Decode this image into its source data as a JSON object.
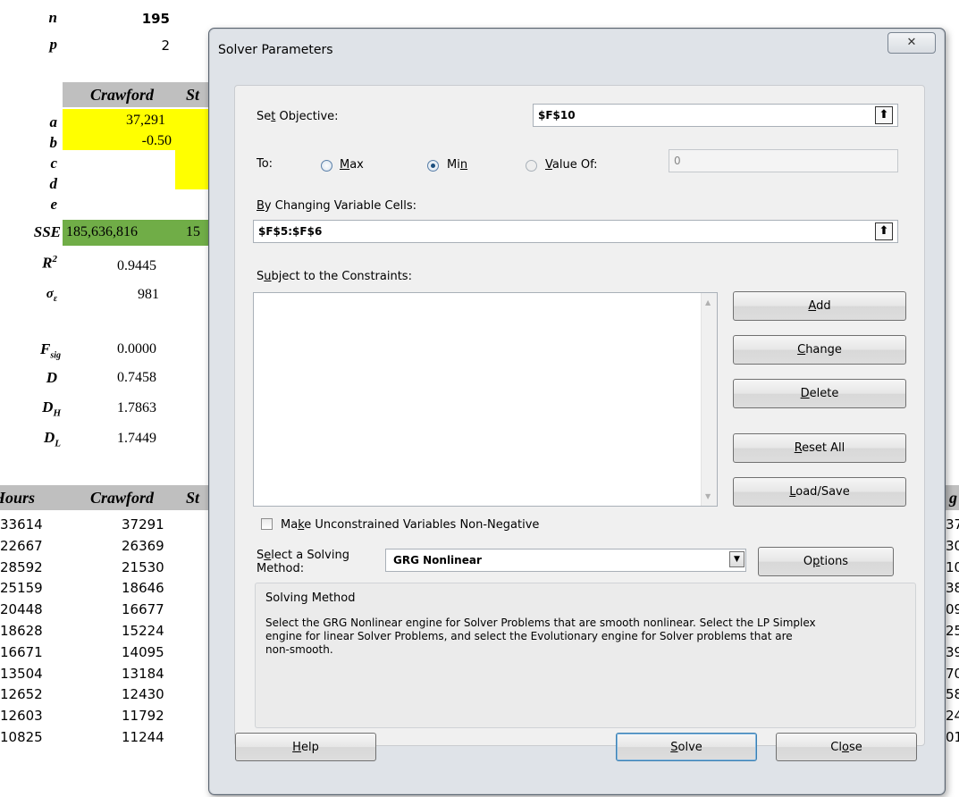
{
  "sheet": {
    "n_label": "n",
    "n_value": "195",
    "p_label": "p",
    "p_value": "2",
    "col_header_1": "Crawford",
    "col_header_2_partial": "St",
    "params": [
      {
        "label": "a",
        "value": "37,291"
      },
      {
        "label": "b",
        "value": "-0.50"
      },
      {
        "label": "c",
        "value": ""
      },
      {
        "label": "d",
        "value": ""
      },
      {
        "label": "e",
        "value": ""
      }
    ],
    "sse_label": "SSE",
    "sse_value": "185,636,816",
    "sse_partial": "15",
    "stats": [
      {
        "label": "R",
        "sup": "2",
        "sub": "",
        "value": "0.9445"
      },
      {
        "label": "σ",
        "sup": "",
        "sub": "ε",
        "value": "981"
      },
      {
        "label": "F",
        "sup": "",
        "sub": "sig",
        "value": "0.0000"
      },
      {
        "label": "D",
        "sup": "",
        "sub": "",
        "value": "0.7458"
      },
      {
        "label": "D",
        "sup": "",
        "sub": "H",
        "value": "1.7863"
      },
      {
        "label": "D",
        "sup": "",
        "sub": "L",
        "value": "1.7449"
      }
    ],
    "table_headers": {
      "hours": "Hours",
      "crawford": "Crawford",
      "st": "St",
      "right_partial": "g"
    },
    "rows": [
      {
        "hours": "33614",
        "crawford": "37291",
        "right": "37"
      },
      {
        "hours": "22667",
        "crawford": "26369",
        "right": "30"
      },
      {
        "hours": "28592",
        "crawford": "21530",
        "right": "10"
      },
      {
        "hours": "25159",
        "crawford": "18646",
        "right": "38"
      },
      {
        "hours": "20448",
        "crawford": "16677",
        "right": "09"
      },
      {
        "hours": "18628",
        "crawford": "15224",
        "right": "25"
      },
      {
        "hours": "16671",
        "crawford": "14095",
        "right": "39"
      },
      {
        "hours": "13504",
        "crawford": "13184",
        "right": "70"
      },
      {
        "hours": "12652",
        "crawford": "12430",
        "right": "58"
      },
      {
        "hours": "12603",
        "crawford": "11792",
        "right": "24"
      },
      {
        "hours": "10825",
        "crawford": "11244",
        "right": "01"
      }
    ]
  },
  "dialog": {
    "title": "Solver Parameters",
    "close_glyph": "✕",
    "set_objective_label": "Set Objective:",
    "objective_value": "$F$10",
    "ref_glyph": "⬆",
    "to_label": "To:",
    "radio_max": "Max",
    "radio_min": "Min",
    "radio_value_of": "Value Of:",
    "value_of_field": "0",
    "selected_radio": "Min",
    "changing_cells_label": "By Changing Variable Cells:",
    "changing_cells_value": "$F$5:$F$6",
    "constraints_label": "Subject to the Constraints:",
    "buttons": {
      "add": "Add",
      "change": "Change",
      "delete": "Delete",
      "reset_all": "Reset All",
      "load_save": "Load/Save",
      "options": "Options",
      "help": "Help",
      "solve": "Solve",
      "close": "Close"
    },
    "nonneg_label": "Make Unconstrained Variables Non-Negative",
    "nonneg_checked": false,
    "solving_method_label_1": "Select a Solving",
    "solving_method_label_2": "Method:",
    "solving_method_value": "GRG Nonlinear",
    "solving_method_title": "Solving Method",
    "solving_method_desc": "Select the GRG Nonlinear engine for Solver Problems that are smooth nonlinear. Select the LP Simplex engine for linear Solver Problems, and select the Evolutionary engine for Solver problems that are non-smooth."
  }
}
